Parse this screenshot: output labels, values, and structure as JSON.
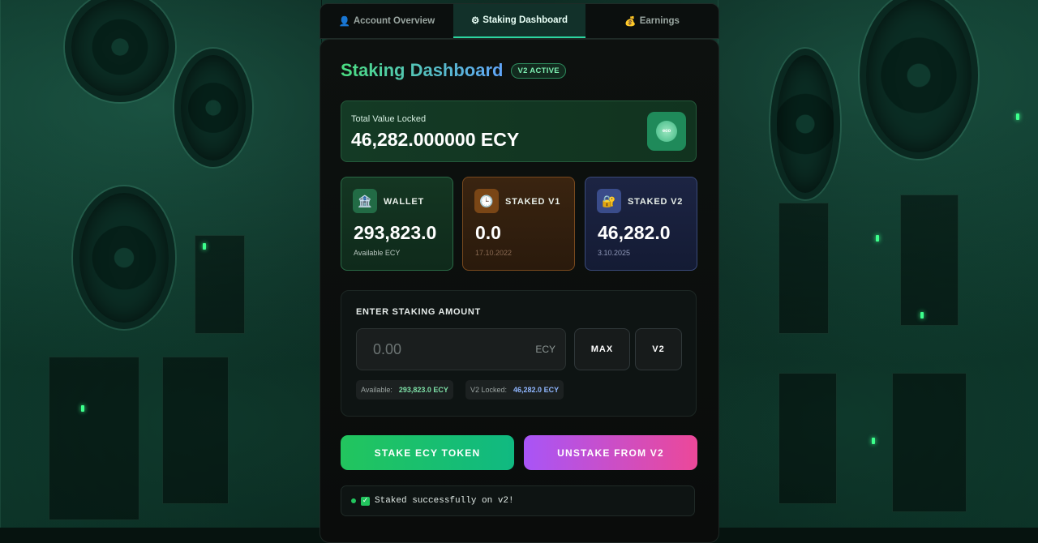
{
  "tabs": [
    {
      "icon": "👤",
      "label": "Account Overview",
      "active": false
    },
    {
      "icon": "⚙",
      "label": "Staking Dashboard",
      "active": true
    },
    {
      "icon": "💰",
      "label": "Earnings",
      "active": false
    }
  ],
  "header": {
    "title": "Staking Dashboard",
    "badge": "V2 ACTIVE"
  },
  "tvl": {
    "label": "Total Value Locked",
    "value": "46,282.000000 ECY",
    "logo_text": "eco"
  },
  "stats": {
    "wallet": {
      "icon": "🏦",
      "name": "WALLET",
      "value": "293,823.0",
      "sub": "Available ECY"
    },
    "staked_v1": {
      "icon": "🕒",
      "name": "STAKED V1",
      "value": "0.0",
      "sub": "17.10.2022"
    },
    "staked_v2": {
      "icon": "🔐",
      "name": "STAKED V2",
      "value": "46,282.0",
      "sub": "3.10.2025"
    }
  },
  "entry": {
    "heading": "ENTER STAKING AMOUNT",
    "placeholder": "0.00",
    "unit": "ECY",
    "max_label": "MAX",
    "version_label": "V2",
    "available_label": "Available:",
    "available_value": "293,823.0 ECY",
    "locked_label": "V2 Locked:",
    "locked_value": "46,282.0 ECY"
  },
  "actions": {
    "stake_label": "STAKE ECY TOKEN",
    "unstake_label": "UNSTAKE FROM V2"
  },
  "status": {
    "text": "Staked successfully on v2!"
  },
  "colors": {
    "accent_green": "#22c55e",
    "accent_purple": "#a855f7",
    "accent_pink": "#ec4899",
    "accent_blue": "#60a5fa"
  }
}
